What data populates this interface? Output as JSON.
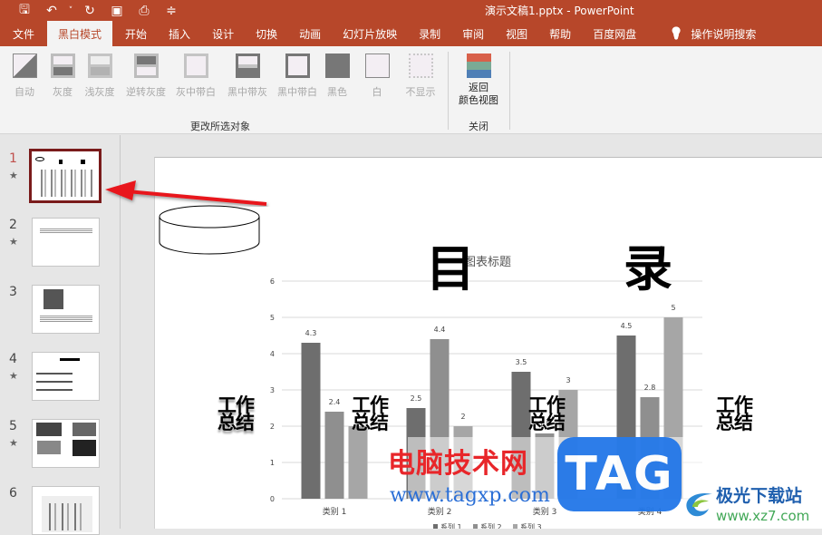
{
  "titlebar": {
    "title": "演示文稿1.pptx  -  PowerPoint",
    "qat": [
      {
        "icon": "save-icon",
        "glyph": "🖫"
      },
      {
        "icon": "undo-icon",
        "glyph": "↶"
      },
      {
        "icon": "undo-dropdown-icon",
        "glyph": "˅"
      },
      {
        "icon": "redo-icon",
        "glyph": "↻"
      },
      {
        "icon": "slideshow-from-start-icon",
        "glyph": "▣"
      },
      {
        "icon": "print-preview-icon",
        "glyph": "⎙"
      },
      {
        "icon": "customize-qat-icon",
        "glyph": "≑"
      }
    ]
  },
  "tabs": [
    {
      "label": "文件"
    },
    {
      "label": "黑白模式",
      "active": true
    },
    {
      "label": "开始"
    },
    {
      "label": "插入"
    },
    {
      "label": "设计"
    },
    {
      "label": "切换"
    },
    {
      "label": "动画"
    },
    {
      "label": "幻灯片放映"
    },
    {
      "label": "录制"
    },
    {
      "label": "审阅"
    },
    {
      "label": "视图"
    },
    {
      "label": "帮助"
    },
    {
      "label": "百度网盘"
    },
    {
      "label": "操作说明搜索",
      "icon": "lightbulb-icon"
    }
  ],
  "ribbon": {
    "change_group": {
      "label": "更改所选对象",
      "buttons": [
        {
          "label": "自动",
          "icon": "auto-icon"
        },
        {
          "label": "灰度",
          "icon": "grayscale-icon"
        },
        {
          "label": "浅灰度",
          "icon": "light-grayscale-icon"
        },
        {
          "label": "逆转灰度",
          "icon": "inverse-grayscale-icon"
        },
        {
          "label": "灰中带白",
          "icon": "gray-with-white-icon"
        },
        {
          "label": "黑中带灰",
          "icon": "black-with-gray-icon"
        },
        {
          "label": "黑中带白",
          "icon": "black-with-white-icon"
        },
        {
          "label": "黑色",
          "icon": "black-icon"
        },
        {
          "label": "白",
          "icon": "white-icon"
        },
        {
          "label": "不显示",
          "icon": "dont-show-icon"
        }
      ]
    },
    "close_group": {
      "label": "关闭",
      "button_line1": "返回",
      "button_line2": "颜色视图",
      "colors": [
        "#d8604a",
        "#7aaa95",
        "#4f7fb6"
      ]
    }
  },
  "slides_panel": {
    "slides": [
      {
        "number": "1",
        "star": true,
        "selected": true
      },
      {
        "number": "2",
        "star": true
      },
      {
        "number": "3",
        "star": false
      },
      {
        "number": "4",
        "star": true
      },
      {
        "number": "5",
        "star": true
      },
      {
        "number": "6",
        "star": false
      }
    ],
    "star_glyph": "★"
  },
  "slide": {
    "title_char_1": "目",
    "title_char_2": "录",
    "work_summary_texts": [
      "工作\n总结",
      "工作\n总结",
      "工作\n总结",
      "工作\n总结"
    ]
  },
  "chart_data": {
    "type": "bar",
    "title": "图表标题",
    "categories": [
      "类别 1",
      "类别 2",
      "类别 3",
      "类别 4"
    ],
    "series": [
      {
        "name": "系列 1",
        "values": [
          4.3,
          2.5,
          3.5,
          4.5
        ],
        "color": "#6e6e6e"
      },
      {
        "name": "系列 2",
        "values": [
          2.4,
          4.4,
          1.8,
          2.8
        ],
        "color": "#8f8f8f"
      },
      {
        "name": "系列 3",
        "values": [
          2,
          2,
          3,
          5
        ],
        "color": "#a6a6a6"
      }
    ],
    "ylim": [
      0,
      6
    ],
    "yticks": [
      0,
      1,
      2,
      3,
      4,
      5,
      6
    ],
    "grid": true,
    "data_labels": true,
    "legend": "bottom",
    "xlabel": "",
    "ylabel": ""
  },
  "watermarks": {
    "red_text": "电脑技术网",
    "url": "www.tagxp.com",
    "tag": "TAG",
    "xz_title": "极光下载站",
    "xz_url": "www.xz7.com"
  }
}
